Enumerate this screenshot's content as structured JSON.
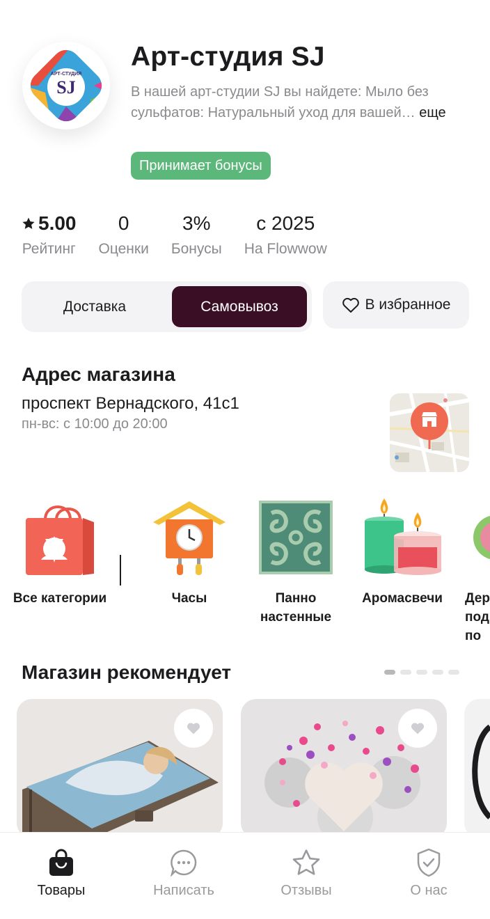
{
  "shop": {
    "title": "Арт-студия SJ",
    "logo_text": "SJ",
    "logo_arc_text": "АРТ-СТУДИЯ",
    "description": "В нашей арт-студии SJ вы найдете: Мыло без сульфатов: Натуральный уход для вашей…",
    "more_label": "еще",
    "bonus_badge": "Принимает бонусы"
  },
  "stats": [
    {
      "value": "5.00",
      "label": "Рейтинг",
      "icon": "star-icon"
    },
    {
      "value": "0",
      "label": "Оценки"
    },
    {
      "value": "3%",
      "label": "Бонусы"
    },
    {
      "value": "с 2025",
      "label": "На Flowwow"
    }
  ],
  "delivery_toggle": {
    "options": [
      "Доставка",
      "Самовывоз"
    ],
    "selected": "Самовывоз"
  },
  "favorite_button": {
    "label": "В избранное",
    "icon": "heart-outline-icon"
  },
  "address": {
    "title": "Адрес магазина",
    "street": "проспект Вернадского, 41с1",
    "hours": "пн-вс: с 10:00 до 20:00"
  },
  "categories": [
    {
      "label": "Все категории",
      "icon": "shopping-bag-icon"
    },
    {
      "label": "Часы",
      "icon": "cuckoo-clock-icon"
    },
    {
      "label": "Панно настенные",
      "icon": "wall-panel-icon"
    },
    {
      "label": "Аромасвечи",
      "icon": "candles-icon"
    },
    {
      "label": "Дер под по",
      "icon": "holder-icon"
    }
  ],
  "recommended": {
    "title": "Магазин рекомендует",
    "page_count": 5,
    "active_page": 1
  },
  "bottom_nav": [
    {
      "label": "Товары",
      "icon": "bag-icon",
      "active": true
    },
    {
      "label": "Написать",
      "icon": "chat-icon",
      "active": false
    },
    {
      "label": "Отзывы",
      "icon": "star-outline-icon",
      "active": false
    },
    {
      "label": "О нас",
      "icon": "shield-check-icon",
      "active": false
    }
  ],
  "colors": {
    "accent_dark": "#3a0e24",
    "bonus_green": "#5cb87a",
    "map_pin": "#f06a52"
  }
}
